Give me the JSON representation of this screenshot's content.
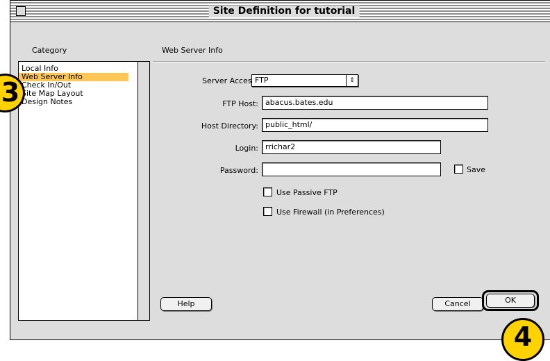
{
  "window": {
    "title": "Site Definition for tutorial"
  },
  "category": {
    "heading": "Category",
    "items": [
      {
        "label": "Local Info",
        "selected": false
      },
      {
        "label": "Web Server Info",
        "selected": true
      },
      {
        "label": "Check In/Out",
        "selected": false
      },
      {
        "label": "Site Map Layout",
        "selected": false
      },
      {
        "label": "Design Notes",
        "selected": false
      }
    ]
  },
  "panel": {
    "heading": "Web Server Info",
    "server_access": {
      "label": "Server Access:",
      "value": "FTP",
      "icon": "popup-arrows-icon"
    },
    "ftp_host": {
      "label": "FTP Host:",
      "value": "abacus.bates.edu"
    },
    "host_directory": {
      "label": "Host Directory:",
      "value": "public_html/"
    },
    "login": {
      "label": "Login:",
      "value": "rrichar2"
    },
    "password": {
      "label": "Password:",
      "value": ""
    },
    "save_checkbox": {
      "label": "Save",
      "checked": false
    },
    "passive_ftp": {
      "label": "Use Passive FTP",
      "checked": false
    },
    "firewall": {
      "label": "Use Firewall (in Preferences)",
      "checked": false
    }
  },
  "buttons": {
    "help": "Help",
    "cancel": "Cancel",
    "ok": "OK"
  },
  "callouts": {
    "step_3": "3",
    "step_4": "4",
    "color": "#ffd200"
  }
}
